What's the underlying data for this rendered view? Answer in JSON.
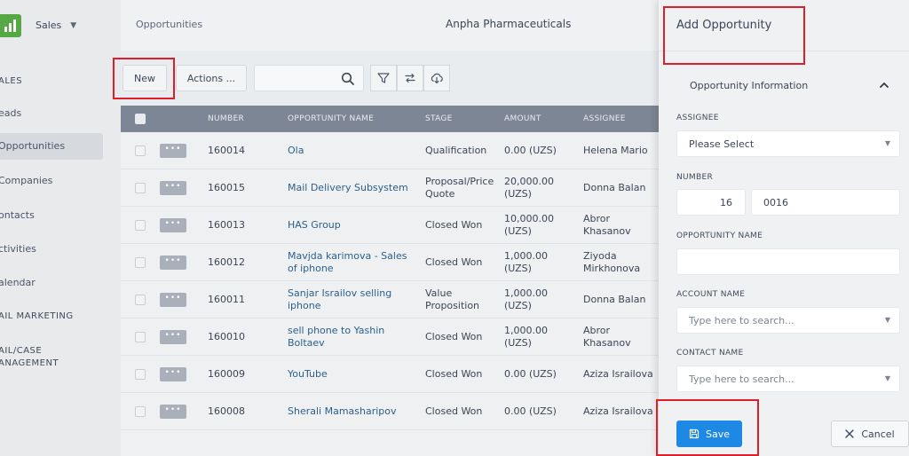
{
  "app": {
    "module": "Sales"
  },
  "sidebar": {
    "items": [
      {
        "label": "ALES"
      },
      {
        "label": "eads"
      },
      {
        "label": "Opportunities"
      },
      {
        "label": "Companies"
      },
      {
        "label": "ontacts"
      },
      {
        "label": "ctivities"
      },
      {
        "label": "alendar"
      },
      {
        "label": "AIL MARKETING"
      },
      {
        "label": "AIL/CASE"
      },
      {
        "label": "ANAGEMENT"
      }
    ]
  },
  "header": {
    "breadcrumb": "Opportunities",
    "organization": "Anpha Pharmaceuticals"
  },
  "toolbar": {
    "new_label": "New",
    "actions_label": "Actions ...",
    "search_value": ""
  },
  "table": {
    "columns": [
      "NUMBER",
      "OPPORTUNITY NAME",
      "STAGE",
      "AMOUNT",
      "ASSIGNEE"
    ],
    "row_menu": "•••",
    "rows": [
      {
        "number": "160014",
        "name": "Ola",
        "stage": "Qualification",
        "amount": "0.00 (UZS)",
        "assignee": "Helena Mario"
      },
      {
        "number": "160015",
        "name": "Mail Delivery Subsystem",
        "stage": "Proposal/Price Quote",
        "amount": "20,000.00 (UZS)",
        "assignee": "Donna Balan"
      },
      {
        "number": "160013",
        "name": "HAS Group",
        "stage": "Closed Won",
        "amount": "10,000.00 (UZS)",
        "assignee": "Abror Khasanov"
      },
      {
        "number": "160012",
        "name": "Mavjda karimova - Sales of iphone",
        "stage": "Closed Won",
        "amount": "1,000.00 (UZS)",
        "assignee": "Ziyoda Mirkhonova"
      },
      {
        "number": "160011",
        "name": "Sanjar Israilov selling iphone",
        "stage": "Value Proposition",
        "amount": "1,000.00 (UZS)",
        "assignee": "Donna Balan"
      },
      {
        "number": "160010",
        "name": "sell phone to Yashin Boltaev",
        "stage": "Closed Won",
        "amount": "1,000.00 (UZS)",
        "assignee": "Abror Khasanov"
      },
      {
        "number": "160009",
        "name": "YouTube",
        "stage": "Closed Won",
        "amount": "0.00 (UZS)",
        "assignee": "Aziza Israilova"
      },
      {
        "number": "160008",
        "name": "Sherali Mamasharipov",
        "stage": "Closed Won",
        "amount": "0.00 (UZS)",
        "assignee": "Aziza Israilova"
      }
    ]
  },
  "panel": {
    "title": "Add Opportunity",
    "section": "Opportunity Information",
    "fields": {
      "assignee": {
        "label": "ASSIGNEE",
        "value": "Please Select"
      },
      "number": {
        "label": "NUMBER",
        "prefix": "16",
        "value": "0016"
      },
      "opportunity_name": {
        "label": "OPPORTUNITY NAME",
        "value": ""
      },
      "account_name": {
        "label": "ACCOUNT NAME",
        "placeholder": "Type here to search..."
      },
      "contact_name": {
        "label": "CONTACT NAME",
        "placeholder": "Type here to search..."
      }
    },
    "save_label": "Save",
    "cancel_label": "Cancel"
  },
  "colors": {
    "primary": "#1e88e5",
    "highlight": "#e01e2b",
    "table_header": "#7d8694",
    "brand_green": "#56a845"
  }
}
